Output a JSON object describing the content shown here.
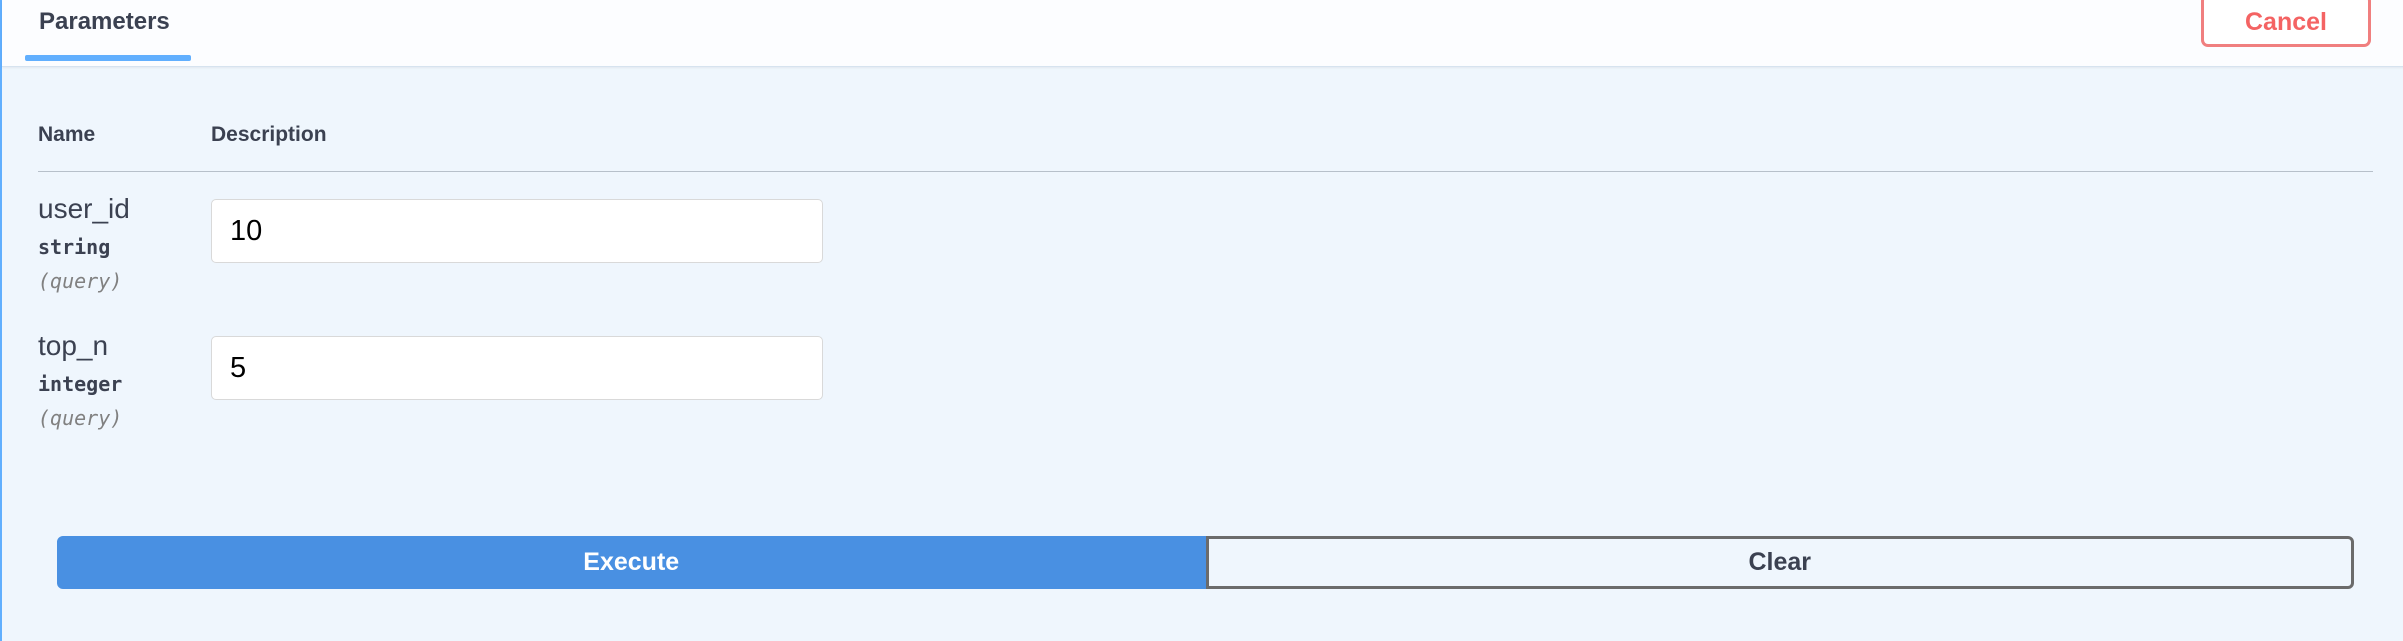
{
  "header": {
    "tab_label": "Parameters",
    "cancel_label": "Cancel"
  },
  "table": {
    "columns": [
      "Name",
      "Description"
    ]
  },
  "parameters": [
    {
      "name": "user_id",
      "type": "string",
      "in": "(query)",
      "value": "10"
    },
    {
      "name": "top_n",
      "type": "integer",
      "in": "(query)",
      "value": "5"
    }
  ],
  "actions": {
    "execute_label": "Execute",
    "clear_label": "Clear"
  },
  "colors": {
    "accent": "#61affe",
    "execute": "#4990e2",
    "cancel": "#f46363",
    "panel_bg": "#eff6fd"
  }
}
